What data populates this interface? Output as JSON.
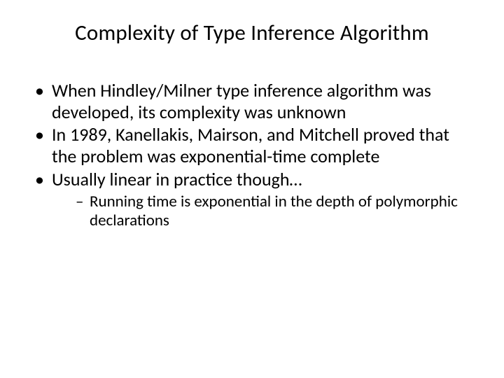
{
  "title": "Complexity of Type Inference Algorithm",
  "bullets": [
    {
      "text": "When Hindley/Milner type inference algorithm was developed, its complexity was unknown"
    },
    {
      "text": "In 1989, Kanellakis, Mairson, and Mitchell proved that the problem was exponential-time complete"
    },
    {
      "text": "Usually linear in practice though…",
      "sub": [
        {
          "text": "Running time is exponential in the depth of polymorphic declarations"
        }
      ]
    }
  ]
}
